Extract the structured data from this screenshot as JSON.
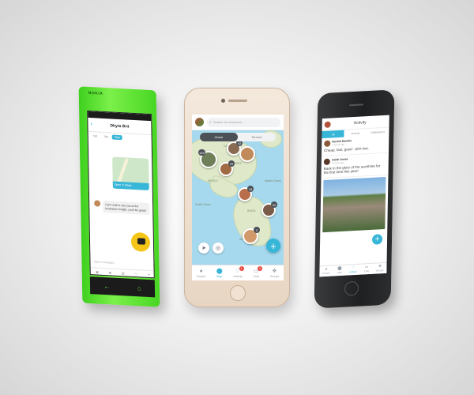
{
  "colors": {
    "accent": "#37b6d8",
    "nokia_green": "#4ee024",
    "badge": "#e8473f",
    "segment_active": "#4c5157"
  },
  "nokia": {
    "brand": "NOKIA",
    "contact_name": "Dhyta Brit",
    "back_icon": "chevron-left-icon",
    "tabs": [
      "Tab",
      "Tab",
      "Map"
    ],
    "map_card_label": "Open in Maps",
    "message": "Can't wait to see you at the fundraiser tonight, you'll be great!",
    "input_placeholder": "Type a message...",
    "toolbar_icons": [
      "camera-icon",
      "location-icon",
      "image-icon",
      "gif-icon",
      "send-icon"
    ]
  },
  "center": {
    "search_placeholder": "Search for someone...",
    "segments": [
      "Home",
      "Recent"
    ],
    "active_segment": "Home",
    "pins": [
      "42",
      "145",
      "29",
      "18",
      "52",
      "2"
    ],
    "tabs": [
      {
        "label": "People",
        "icon": "people-icon",
        "badge": ""
      },
      {
        "label": "Map",
        "icon": "map-pin-icon",
        "badge": ""
      },
      {
        "label": "Activity",
        "icon": "activity-icon",
        "badge": "1"
      },
      {
        "label": "Chat",
        "icon": "chat-icon",
        "badge": "4"
      },
      {
        "label": "Groups",
        "icon": "groups-icon",
        "badge": ""
      }
    ],
    "active_tab": "Map",
    "map_labels": {
      "canada": "CANADA",
      "usa": "UNITED STATES",
      "mexico": "MEXICO",
      "brazil": "BRAZIL",
      "argentina": "ARGENTINA",
      "atlantic": "Atlantic Ocean",
      "pacific": "Pacific Ocean"
    }
  },
  "right": {
    "title": "Activity",
    "tabs": [
      "All",
      "Friends",
      "Notifications"
    ],
    "active_tab": "All",
    "posts": [
      {
        "name": "Rachel Daniels",
        "meta": "2 hours ago",
        "text": "Cheap, fast, good - pick two."
      },
      {
        "name": "Caleb Jones",
        "meta": "3 hours ago",
        "text": "Bask in the glory of the sunshine for the first time this year!"
      }
    ],
    "tabs_bottom": [
      "People",
      "Map",
      "Activity",
      "Chat",
      "Groups"
    ]
  }
}
